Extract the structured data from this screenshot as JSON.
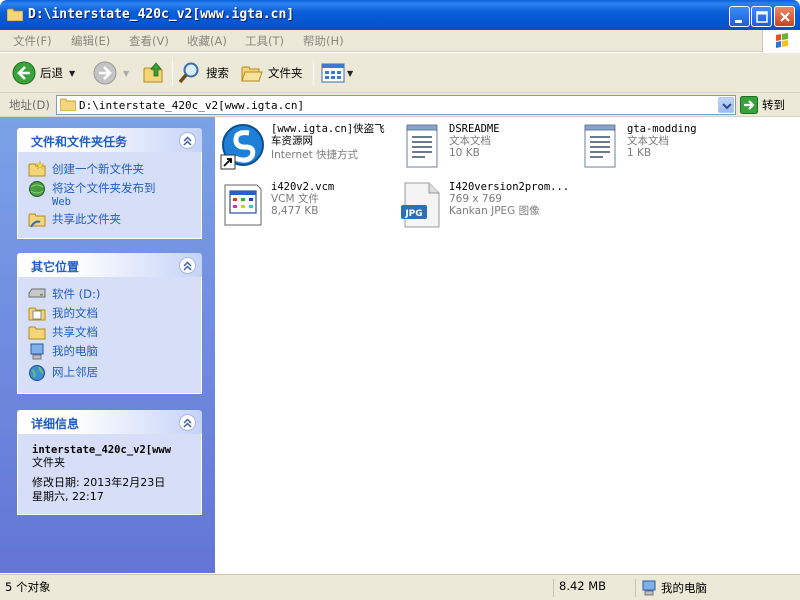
{
  "window": {
    "title": "D:\\interstate_420c_v2[www.igta.cn]"
  },
  "menu": [
    "文件(F)",
    "编辑(E)",
    "查看(V)",
    "收藏(A)",
    "工具(T)",
    "帮助(H)"
  ],
  "toolbar": {
    "back": "后退",
    "search": "搜索",
    "folders": "文件夹"
  },
  "address": {
    "label": "地址(D)",
    "value": "D:\\interstate_420c_v2[www.igta.cn]",
    "go": "转到"
  },
  "tasks": {
    "title": "文件和文件夹任务",
    "items": [
      "创建一个新文件夹",
      "将这个文件夹发布到",
      "Web",
      "共享此文件夹"
    ]
  },
  "places": {
    "title": "其它位置",
    "items": [
      "软件 (D:)",
      "我的文档",
      "共享文档",
      "我的电脑",
      "网上邻居"
    ]
  },
  "details": {
    "title": "详细信息",
    "name": "interstate_420c_v2[www",
    "type": "文件夹",
    "modified_label": "修改日期: 2013年2月23日",
    "modified_time": "星期六, 22:17"
  },
  "files": [
    {
      "name1": "[www.igta.cn]侠盗飞",
      "name2": "车资源网",
      "sub1": "Internet 快捷方式",
      "sub2": "",
      "icon": "internet-shortcut-icon"
    },
    {
      "name1": "DSREADME",
      "name2": "",
      "sub1": "文本文档",
      "sub2": "10 KB",
      "icon": "text-document-icon"
    },
    {
      "name1": "gta-modding",
      "name2": "",
      "sub1": "文本文档",
      "sub2": "1 KB",
      "icon": "text-document-icon"
    },
    {
      "name1": "i420v2.vcm",
      "name2": "",
      "sub1": "VCM 文件",
      "sub2": "8,477 KB",
      "icon": "vcm-file-icon"
    },
    {
      "name1": "I420version2prom...",
      "name2": "",
      "sub1": "769 x 769",
      "sub2": "Kankan JPEG 图像",
      "icon": "jpeg-image-icon"
    }
  ],
  "status": {
    "objects": "5 个对象",
    "size": "8.42 MB",
    "location": "我的电脑"
  }
}
